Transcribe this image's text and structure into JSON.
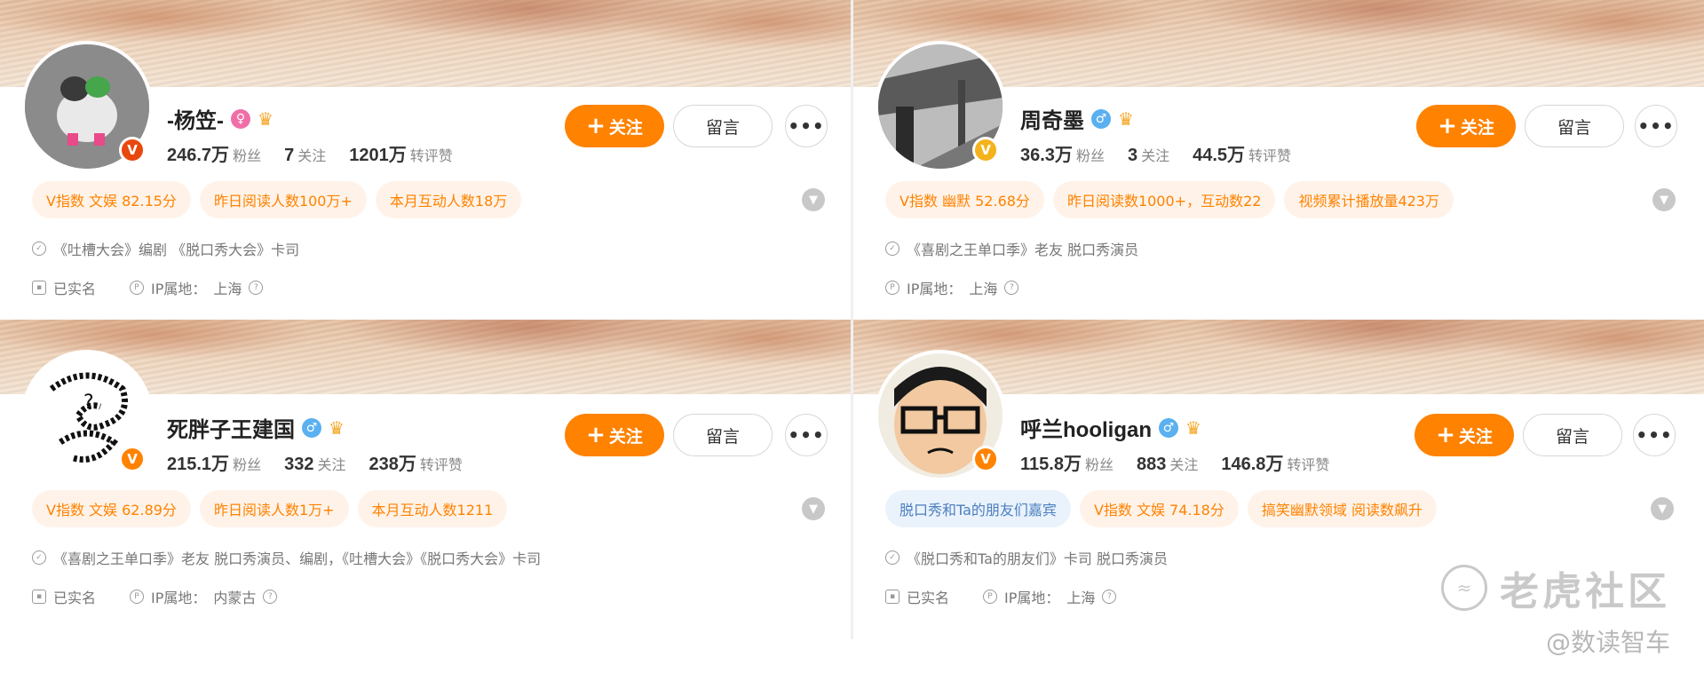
{
  "colors": {
    "accent": "#ff8200",
    "tag_bg": "#fff3e9",
    "blue_tag_bg": "#eaf2fc",
    "male": "#5ab0f0",
    "female": "#f06ea8",
    "vip_red": "#e8480d",
    "vip_gold": "#f4b31c"
  },
  "buttons": {
    "follow": "关注",
    "message": "留言",
    "more": "•••"
  },
  "labels": {
    "fans": "粉丝",
    "following": "关注",
    "interactions": "转评赞",
    "verified": "已实名",
    "ip_prefix": "IP属地："
  },
  "profiles": [
    {
      "name": "-杨笠-",
      "gender_icon": "female-icon",
      "gender_symbol": "♀",
      "verify_icon": "orange-v-badge-icon",
      "verify_letter": "V",
      "fans": "246.7万",
      "following": "7",
      "interactions": "1201万",
      "tags": [
        "V指数 文娱 82.15分",
        "昨日阅读人数100万+",
        "本月互动人数18万"
      ],
      "bio": "《吐槽大会》编剧 《脱口秀大会》卡司",
      "verified_label": "已实名",
      "ip": "上海"
    },
    {
      "name": "周奇墨",
      "gender_icon": "male-icon",
      "gender_symbol": "♂",
      "verify_icon": "yellow-v-badge-icon",
      "verify_letter": "V",
      "fans": "36.3万",
      "following": "3",
      "interactions": "44.5万",
      "tags": [
        "V指数 幽默 52.68分",
        "昨日阅读数1000+，互动数22",
        "视频累计播放量423万"
      ],
      "bio": "《喜剧之王单口季》老友 脱口秀演员",
      "verified_label": "",
      "ip": "上海"
    },
    {
      "name": "死胖子王建国",
      "gender_icon": "male-icon",
      "gender_symbol": "♂",
      "verify_icon": "orange-v-badge-icon",
      "verify_letter": "V",
      "fans": "215.1万",
      "following": "332",
      "interactions": "238万",
      "tags": [
        "V指数 文娱 62.89分",
        "昨日阅读人数1万+",
        "本月互动人数1211"
      ],
      "bio": "《喜剧之王单口季》老友 脱口秀演员、编剧，《吐槽大会》《脱口秀大会》卡司",
      "verified_label": "已实名",
      "ip": "内蒙古"
    },
    {
      "name": "呼兰hooligan",
      "gender_icon": "male-icon",
      "gender_symbol": "♂",
      "verify_icon": "orange-v-badge-icon",
      "verify_letter": "V",
      "fans": "115.8万",
      "following": "883",
      "interactions": "146.8万",
      "tags": [
        "脱口秀和Ta的朋友们嘉宾",
        "V指数 文娱 74.18分",
        "搞笑幽默领域 阅读数飙升"
      ],
      "bio": "《脱口秀和Ta的朋友们》卡司 脱口秀演员",
      "verified_label": "已实名",
      "ip": "上海"
    }
  ],
  "watermark": {
    "brand": "老虎社区",
    "handle": "@数读智车"
  }
}
